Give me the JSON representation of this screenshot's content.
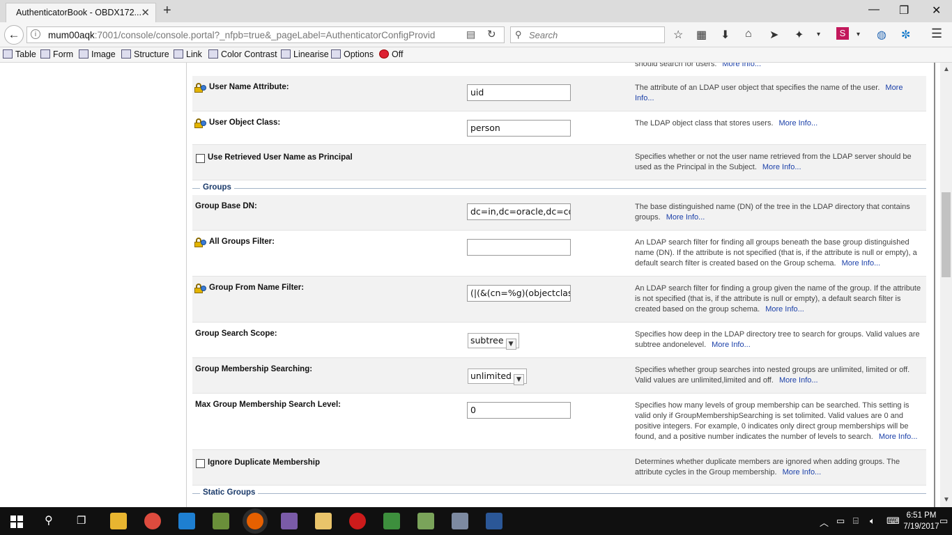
{
  "browser": {
    "tab_title": "AuthenticatorBook - OBDX172...",
    "url_host": "mum00aqk",
    "url_rest": ":7001/console/console.portal?_nfpb=true&_pageLabel=AuthenticatorConfigProvid",
    "search_placeholder": "Search"
  },
  "bookmarks": [
    {
      "label": "Table"
    },
    {
      "label": "Form"
    },
    {
      "label": "Image"
    },
    {
      "label": "Structure"
    },
    {
      "label": "Link"
    },
    {
      "label": "Color Contrast"
    },
    {
      "label": "Linearise"
    },
    {
      "label": "Options"
    },
    {
      "label": "Off"
    }
  ],
  "page": {
    "top_fragment": "should search for users.",
    "more_info": "More Info...",
    "rows_users": [
      {
        "label": "User Name Attribute:",
        "value": "uid",
        "desc": "The attribute of an LDAP user object that specifies the name of the user."
      },
      {
        "label": "User Object Class:",
        "value": "person",
        "desc": "The LDAP object class that stores users."
      },
      {
        "label": "Use Retrieved User Name as Principal",
        "desc": "Specifies whether or not the user name retrieved from the LDAP server should be used as the Principal in the Subject."
      }
    ],
    "section_groups": "Groups",
    "rows_groups": [
      {
        "label": "Group Base DN:",
        "value": "dc=in,dc=oracle,dc=com",
        "desc": "The base distinguished name (DN) of the tree in the LDAP directory that contains groups."
      },
      {
        "label": "All Groups Filter:",
        "value": "",
        "desc": "An LDAP search filter for finding all groups beneath the base group distinguished name (DN). If the attribute is not specified (that is, if the attribute is null or empty), a default search filter is created based on the Group schema."
      },
      {
        "label": "Group From Name Filter:",
        "value": "(|(&(cn=%g)(objectclass",
        "desc": "An LDAP search filter for finding a group given the name of the group. If the attribute is not specified (that is, if the attribute is null or empty), a default search filter is created based on the group schema."
      },
      {
        "label": "Group Search Scope:",
        "value": "subtree",
        "desc": "Specifies how deep in the LDAP directory tree to search for groups. Valid values are subtree andonelevel."
      },
      {
        "label": "Group Membership Searching:",
        "value": "unlimited",
        "desc": "Specifies whether group searches into nested groups are unlimited, limited or off. Valid values are unlimited,limited and off."
      },
      {
        "label": "Max Group Membership Search Level:",
        "value": "0",
        "desc": "Specifies how many levels of group membership can be searched. This setting is valid only if GroupMembershipSearching is set tolimited. Valid values are 0 and positive integers. For example, 0 indicates only direct group memberships will be found, and a positive number indicates the number of levels to search."
      },
      {
        "label": "Ignore Duplicate Membership",
        "desc": "Determines whether duplicate members are ignored when adding groups. The attribute cycles in the Group membership."
      }
    ],
    "section_static": "Static Groups"
  },
  "taskbar": {
    "time": "6:51 PM",
    "date": "7/19/2017"
  },
  "colors": {
    "accent_link": "#1a3fa8",
    "section_title": "#1a3a6a"
  }
}
